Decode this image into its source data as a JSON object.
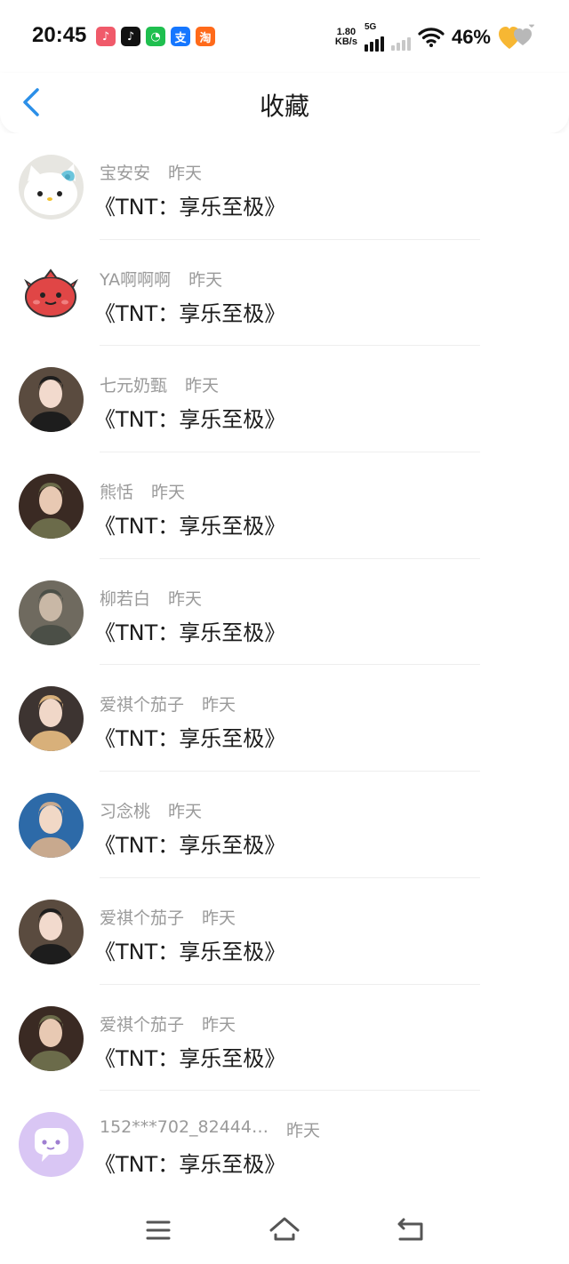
{
  "status_bar": {
    "time": "20:45",
    "apps": [
      {
        "icon": "xiaohongshu-app-icon",
        "glyph": "♪",
        "color": "#f05a6a"
      },
      {
        "icon": "douyin-app-icon",
        "glyph": "♪",
        "color": "#111111"
      },
      {
        "icon": "wechat-app-icon",
        "glyph": "◔",
        "color": "#1fbf4f"
      },
      {
        "icon": "alipay-app-icon",
        "glyph": "支",
        "color": "#1677ff"
      },
      {
        "icon": "taobao-app-icon",
        "glyph": "淘",
        "color": "#ff6a1a"
      }
    ],
    "net_speed_value": "1.80",
    "net_speed_unit": "KB/s",
    "network": "5G",
    "battery": "46%",
    "heart_colors": [
      "#f7b733",
      "#b8b8b8"
    ]
  },
  "header": {
    "title": "收藏",
    "back_icon": "back-chevron-icon",
    "accent": "#2b8fe8"
  },
  "favorites": [
    {
      "name": "宝安安",
      "time": "昨天",
      "content": "《TNT：享乐至极》",
      "avatar": "hello-kitty-avatar"
    },
    {
      "name": "YA啊啊啊",
      "time": "昨天",
      "content": "《TNT：享乐至极》",
      "avatar": "red-devil-avatar"
    },
    {
      "name": "七元奶甄",
      "time": "昨天",
      "content": "《TNT：享乐至极》",
      "avatar": "photo-avatar"
    },
    {
      "name": "熊恬",
      "time": "昨天",
      "content": "《TNT：享乐至极》",
      "avatar": "photo-avatar"
    },
    {
      "name": "柳若白",
      "time": "昨天",
      "content": "《TNT：享乐至极》",
      "avatar": "photo-avatar"
    },
    {
      "name": "爱祺个茄子",
      "time": "昨天",
      "content": "《TNT：享乐至极》",
      "avatar": "photo-avatar"
    },
    {
      "name": "习念桃",
      "time": "昨天",
      "content": "《TNT：享乐至极》",
      "avatar": "photo-avatar"
    },
    {
      "name": "爱祺个茄子",
      "time": "昨天",
      "content": "《TNT：享乐至极》",
      "avatar": "photo-avatar"
    },
    {
      "name": "爱祺个茄子",
      "time": "昨天",
      "content": "《TNT：享乐至极》",
      "avatar": "photo-avatar"
    },
    {
      "name": "152***702_82444…",
      "time": "昨天",
      "content": "《TNT：享乐至极》",
      "avatar": "default-chat-avatar"
    }
  ],
  "bottom_nav": {
    "menu_icon": "menu-icon",
    "home_icon": "home-icon",
    "back_icon": "back-icon"
  }
}
